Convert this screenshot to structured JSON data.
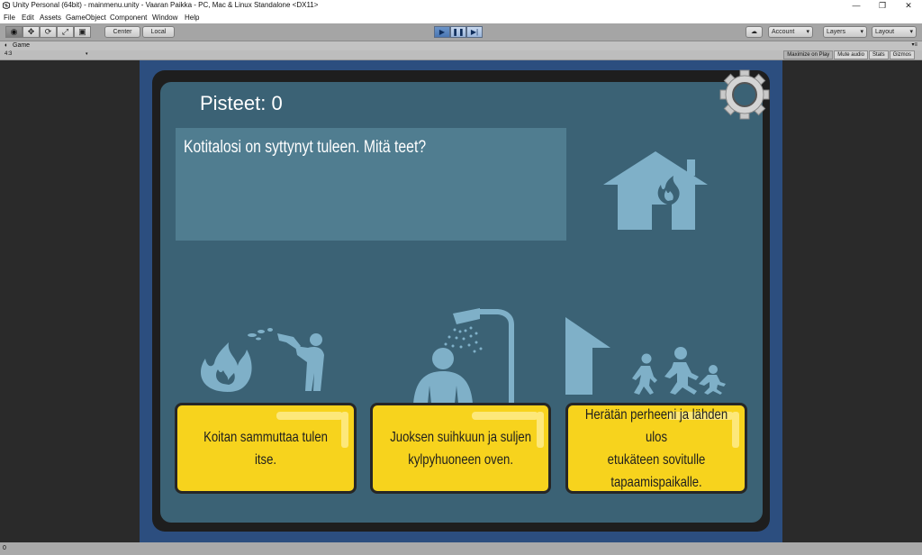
{
  "window": {
    "title": "Unity Personal (64bit) - mainmenu.unity - Vaaran Paikka - PC, Mac & Linux Standalone <DX11>",
    "controls": {
      "minimize": "—",
      "restore": "❐",
      "close": "✕"
    }
  },
  "menu": [
    "File",
    "Edit",
    "Assets",
    "GameObject",
    "Component",
    "Window",
    "Help"
  ],
  "toolbar": {
    "tools": [
      "hand-tool-icon",
      "move-tool-icon",
      "rotate-tool-icon",
      "scale-tool-icon",
      "rect-tool-icon"
    ],
    "pivot": "Center",
    "space": "Local",
    "play_controls": [
      "play-icon",
      "pause-icon",
      "step-icon"
    ],
    "account": "Account",
    "layers": "Layers",
    "layout": "Layout"
  },
  "game_tab": {
    "label": "Game",
    "aspect": "4:3",
    "buttons": [
      "Maximize on Play",
      "Mute audio",
      "Stats",
      "Gizmos"
    ]
  },
  "game": {
    "score_text": "Pisteet: 0",
    "question": "Kotitalosi on syttynyt tuleen. Mitä teet?",
    "answers": [
      {
        "line1": "Koitan sammuttaa tulen itse.",
        "line2": "",
        "line3": ""
      },
      {
        "line1": "Juoksen suihkuun ja suljen",
        "line2": "kylpyhuoneen oven.",
        "line3": ""
      },
      {
        "line1": "Herätän perheeni ja lähden ulos",
        "line2": "etukäteen sovitulle",
        "line3": "tapaamispaikalle."
      }
    ]
  },
  "status": {
    "text": "0"
  },
  "colors": {
    "panel_bg": "#3b6275",
    "question_box": "#507d90",
    "answer_button": "#f7d31d",
    "icon": "#7fb0c8",
    "frame": "#1e1e1e",
    "game_border": "#2c4e7f"
  }
}
